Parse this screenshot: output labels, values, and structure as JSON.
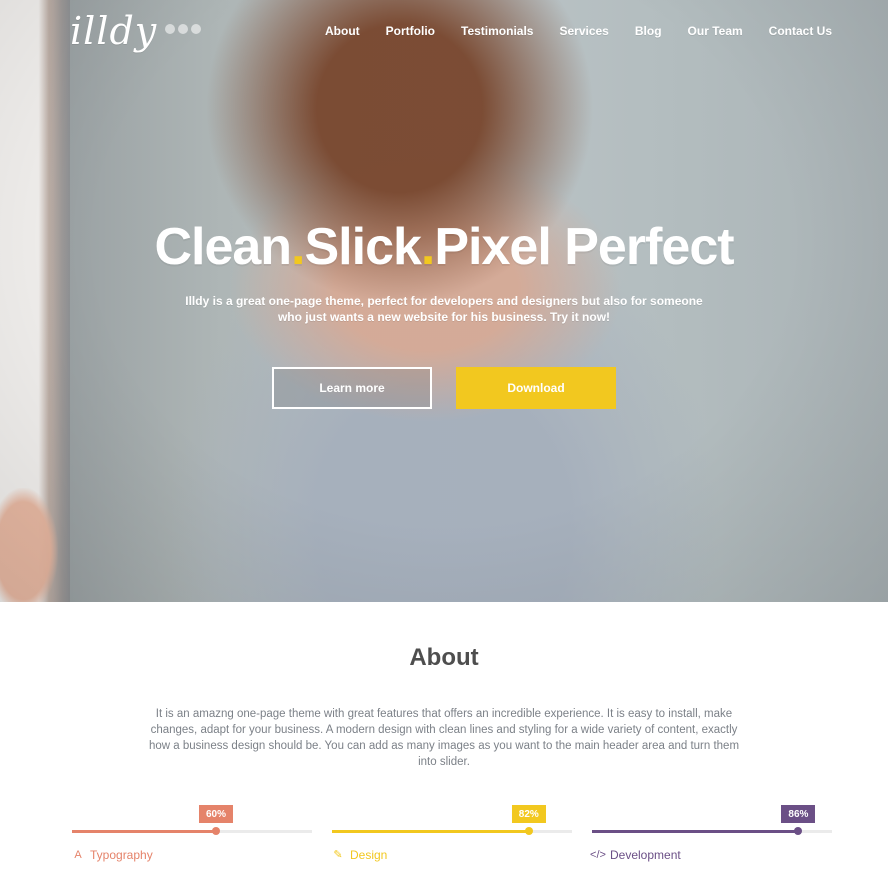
{
  "brand": {
    "logo_text": "illdy"
  },
  "nav": {
    "items": [
      {
        "label": "About"
      },
      {
        "label": "Portfolio"
      },
      {
        "label": "Testimonials"
      },
      {
        "label": "Services"
      },
      {
        "label": "Blog"
      },
      {
        "label": "Our Team"
      },
      {
        "label": "Contact Us"
      }
    ]
  },
  "hero": {
    "headline": {
      "part1": "Clean",
      "part2": "Slick",
      "part3": "Pixel Perfect",
      "dot": "."
    },
    "subtitle": "Illdy is a great one-page theme, perfect for developers and designers but also for someone who just wants a new website for his business. Try it now!",
    "buttons": {
      "learn_more": "Learn more",
      "download": "Download"
    }
  },
  "about": {
    "title": "About",
    "text": "It is an amazng one-page theme with great features that offers an incredible experience. It is easy to install, make changes, adapt for your business. A modern design with clean lines and styling for a wide variety of content, exactly how a business design should be. You can add as many images as you want to the main header area and turn them into slider.",
    "skills": [
      {
        "label": "Typography",
        "percent": 60,
        "percent_label": "60%",
        "color": "#e5836a",
        "icon": "typography-icon"
      },
      {
        "label": "Design",
        "percent": 82,
        "percent_label": "82%",
        "color": "#f2c81f",
        "icon": "pencil-icon"
      },
      {
        "label": "Development",
        "percent": 86,
        "percent_label": "86%",
        "color": "#6b4f86",
        "icon": "code-icon"
      }
    ]
  }
}
